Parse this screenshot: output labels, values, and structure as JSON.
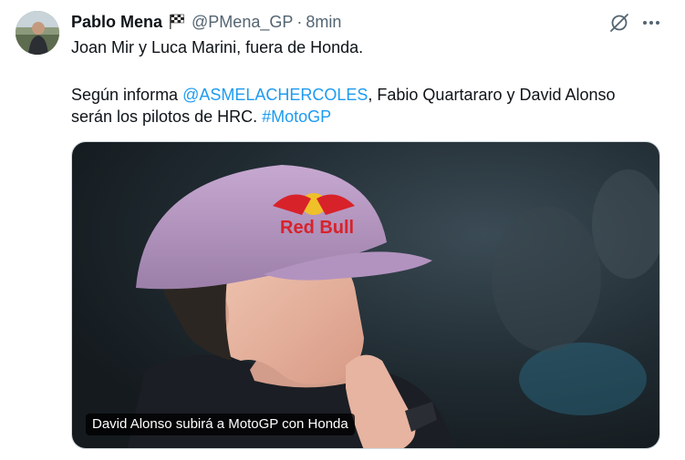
{
  "tweet": {
    "author_name": "Pablo Mena",
    "handle": "@PMena_GP",
    "separator": "·",
    "time": "8min",
    "line1": "Joan Mir y Luca Marini, fuera de Honda.",
    "line2_prefix": "Según informa ",
    "mention": "@ASMELACHERCOLES",
    "line2_mid": ", Fabio Quartararo y David Alonso",
    "line3_prefix": "serán los pilotos de HRC. ",
    "hashtag": "#MotoGP"
  },
  "media": {
    "caption": "David Alonso subirá a MotoGP con Honda",
    "cap_brand_text": "Red Bull"
  },
  "icons": {
    "flag": "checkered-flag-icon",
    "grok": "grok-icon",
    "more": "more-dots-icon"
  },
  "colors": {
    "link": "#1d9bf0",
    "secondary_text": "#536471",
    "cap": "#b89bc4"
  }
}
